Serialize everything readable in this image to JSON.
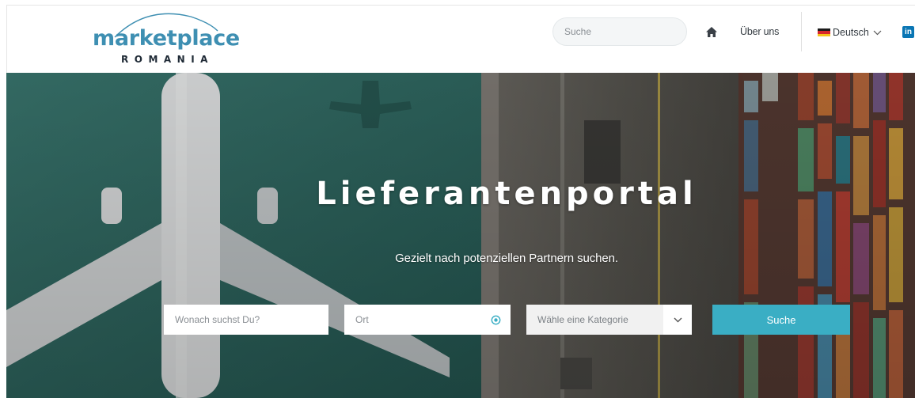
{
  "header": {
    "logo": {
      "name": "marketplace",
      "sub": "ROMANIA"
    },
    "search_placeholder": "Suche",
    "nav": {
      "about": "Über uns"
    },
    "language": {
      "selected": "Deutsch"
    },
    "social": {
      "linkedin": "in"
    }
  },
  "hero": {
    "title": "Lieferantenportal",
    "subtitle": "Gezielt nach potenziellen Partnern suchen.",
    "form": {
      "what_placeholder": "Wonach suchst Du?",
      "where_placeholder": "Ort",
      "category_placeholder": "Wähle eine Kategorie",
      "submit_label": "Suche"
    }
  },
  "colors": {
    "brand_blue": "#3e8fb2",
    "dark_navy": "#1f2a36",
    "accent_teal": "#3aaec4",
    "linkedin_blue": "#0a76b4"
  },
  "icons": [
    "home-icon",
    "flag-de-icon",
    "chevron-down-icon",
    "linkedin-icon",
    "location-target-icon"
  ]
}
